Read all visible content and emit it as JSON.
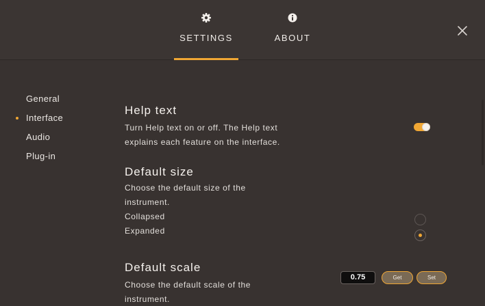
{
  "tabs": [
    {
      "label": "SETTINGS",
      "icon": "gear-icon",
      "active": true
    },
    {
      "label": "ABOUT",
      "icon": "info-icon",
      "active": false
    }
  ],
  "sidebar": {
    "items": [
      {
        "label": "General",
        "active": false
      },
      {
        "label": "Interface",
        "active": true
      },
      {
        "label": "Audio",
        "active": false
      },
      {
        "label": "Plug-in",
        "active": false
      }
    ]
  },
  "help_text": {
    "title": "Help text",
    "desc_line1": "Turn Help text on or off. The Help text",
    "desc_line2": "explains each feature on the interface.",
    "enabled": true
  },
  "default_size": {
    "title": "Default size",
    "desc_line1": "Choose the default size of the",
    "desc_line2": "instrument.",
    "options": [
      {
        "label": "Collapsed",
        "selected": false
      },
      {
        "label": "Expanded",
        "selected": true
      }
    ]
  },
  "default_scale": {
    "title": "Default scale",
    "desc_line1": "Choose the default scale of the",
    "desc_line2": "instrument.",
    "value": "0.75",
    "get_label": "Get",
    "set_label": "Set"
  },
  "colors": {
    "accent": "#f0a734",
    "background": "#383230"
  }
}
